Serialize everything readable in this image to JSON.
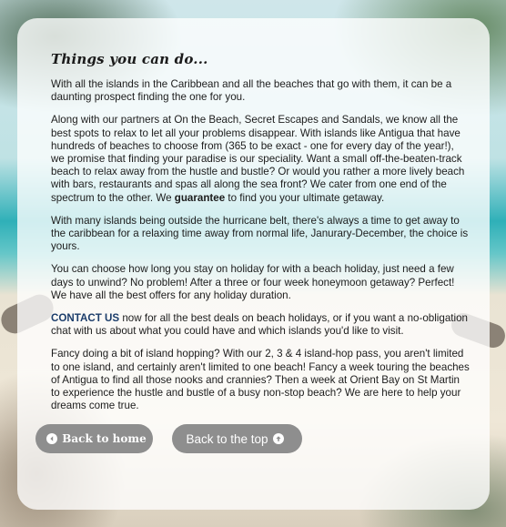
{
  "page": {
    "title": "Things you can do...",
    "paragraphs": {
      "p1": "With all the islands in the Caribbean and all the beaches that go with them, it can be a daunting prospect finding the one for you.",
      "p2a": "Along with our partners at On the Beach, Secret Escapes and Sandals, we know all the best spots to relax to let all your problems disappear. With islands like Antigua that have hundreds of beaches to choose from (365 to be exact - one for every day of the year!), we promise that finding your paradise is our speciality. Want a small off-the-beaten-track beach to relax away from the hustle and bustle? Or would you rather a more lively beach with bars, restaurants and spas all along the sea front? We cater from one end of the spectrum to the other. We ",
      "p2_strong": "guarantee",
      "p2b": " to find you your ultimate getaway.",
      "p3": "With many islands being outside the hurricane belt, there's always a time to get away to the caribbean for a relaxing time away from normal life, Janurary-December, the choice is yours.",
      "p4": "You can choose how long you stay on holiday for with a beach holiday, just need a few days to unwind? No problem! After a three or four week honeymoon getaway? Perfect! We have all the best offers for any holiday duration.",
      "p5_link": "CONTACT US",
      "p5_rest": " now for all the best deals on beach holidays, or if you want a no-obligation chat with us about what you could have and which islands you'd like to visit.",
      "p6": "Fancy doing a bit of island hopping? With our 2, 3 & 4 island-hop pass, you aren't limited to one island, and certainly aren't limited to one beach! Fancy a week touring the beaches of Antigua to find all those nooks and crannies? Then a week at Orient Bay on St Martin to experience the hustle and bustle of a busy non-stop beach? We are here to help your dreams come true."
    }
  },
  "buttons": {
    "back_home": "Back to home",
    "back_top": "Back to the top"
  },
  "icons": {
    "back_home": "arrow-left-circle-icon",
    "back_top": "arrow-up-circle-icon"
  },
  "colors": {
    "button_bg": "#8e8e8e",
    "link": "#1c3d6b"
  }
}
